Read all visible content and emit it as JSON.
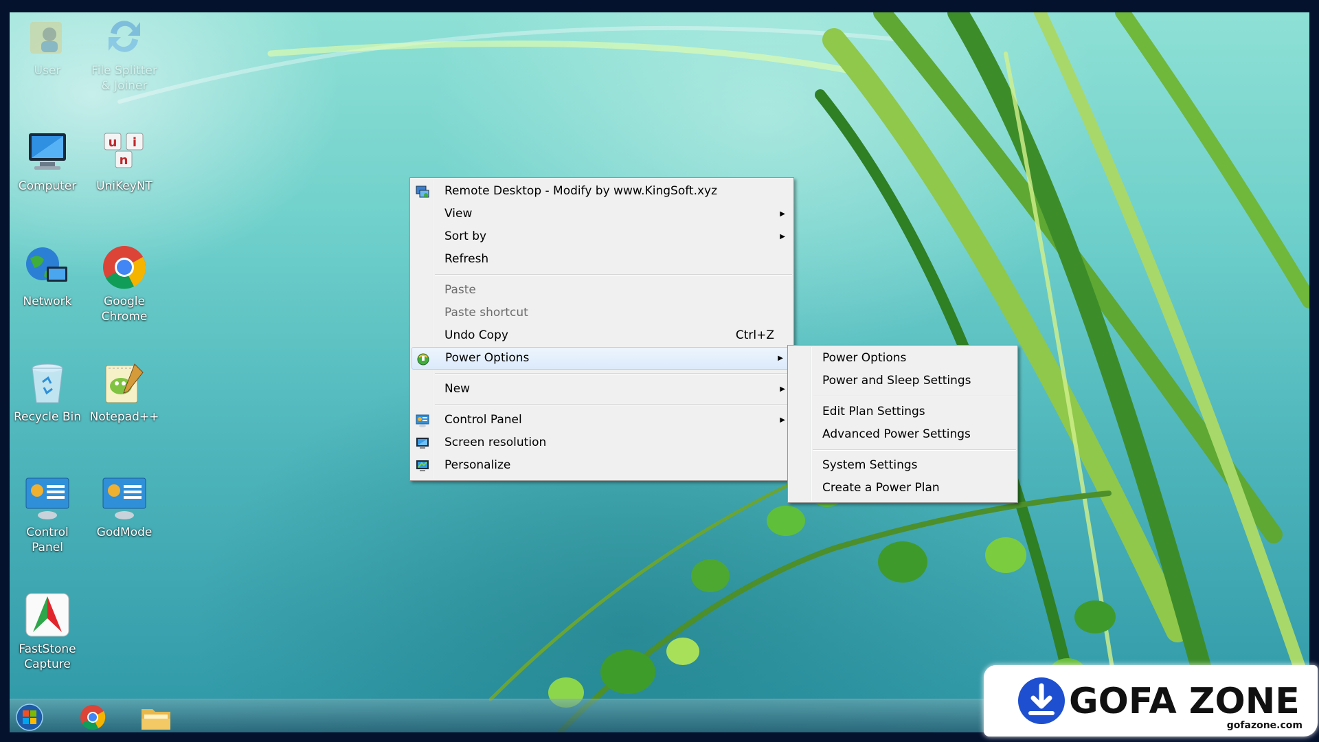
{
  "desktop_icons": [
    {
      "name": "user-folder-icon",
      "label": "User",
      "faded": true
    },
    {
      "name": "file-splitter-icon",
      "label": "File Splitter & Joiner",
      "faded": true
    },
    {
      "name": "computer-icon",
      "label": "Computer"
    },
    {
      "name": "unikey-icon",
      "label": "UniKeyNT"
    },
    {
      "name": "network-icon",
      "label": "Network"
    },
    {
      "name": "chrome-icon",
      "label": "Google Chrome"
    },
    {
      "name": "recycle-bin-icon",
      "label": "Recycle Bin"
    },
    {
      "name": "notepadpp-icon",
      "label": "Notepad++"
    },
    {
      "name": "control-panel-icon",
      "label": "Control Panel"
    },
    {
      "name": "godmode-icon",
      "label": "GodMode"
    },
    {
      "name": "faststone-icon",
      "label": "FastStone Capture"
    }
  ],
  "context_menu": {
    "items": [
      {
        "label": "Remote Desktop - Modify by www.KingSoft.xyz",
        "icon": "remote-desktop-icon"
      },
      {
        "label": "View",
        "submenu": true
      },
      {
        "label": "Sort by",
        "submenu": true
      },
      {
        "label": "Refresh"
      },
      {
        "label": "Paste",
        "disabled": true
      },
      {
        "label": "Paste shortcut",
        "disabled": true
      },
      {
        "label": "Undo Copy",
        "accel": "Ctrl+Z"
      },
      {
        "label": "Power Options",
        "icon": "power-options-icon",
        "submenu": true,
        "active": true
      },
      {
        "label": "New",
        "submenu": true
      },
      {
        "label": "Control Panel",
        "icon": "control-panel-small-icon",
        "submenu": true
      },
      {
        "label": "Screen resolution",
        "icon": "screen-resolution-icon"
      },
      {
        "label": "Personalize",
        "icon": "personalize-icon"
      }
    ]
  },
  "power_submenu": {
    "items": [
      {
        "label": "Power Options"
      },
      {
        "label": "Power and Sleep Settings"
      },
      {
        "label": "Edit Plan Settings"
      },
      {
        "label": "Advanced Power Settings"
      },
      {
        "label": "System Settings"
      },
      {
        "label": "Create a Power Plan"
      }
    ]
  },
  "taskbar": {
    "buttons": [
      "start-orb-icon",
      "chrome-taskbar-icon",
      "explorer-taskbar-icon"
    ]
  },
  "watermark": {
    "brand": "GOFA ZONE",
    "domain": "gofazone.com"
  },
  "colors": {
    "accent_blue": "#1d4fd0",
    "menu_bg": "#f0f0f0"
  }
}
